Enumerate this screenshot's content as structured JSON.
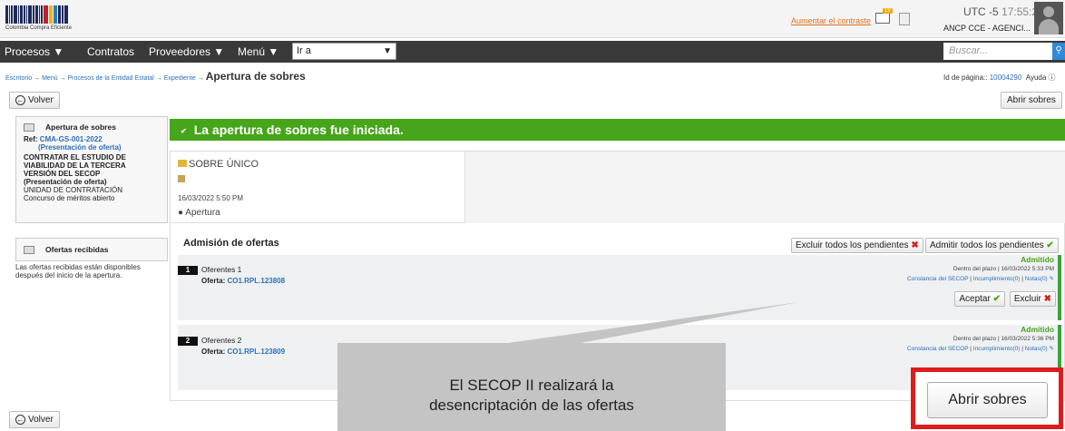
{
  "header": {
    "logo_text": "Colombia Compra Eficiente",
    "contrast_link": "Aumentar el contraste",
    "mail_badge": "19",
    "clock_tz": "UTC -5",
    "clock_time": "17:55:28",
    "account": "ANCP CCE - AGENCI..."
  },
  "nav": {
    "items": [
      "Procesos ▼",
      "Contratos",
      "Proveedores ▼",
      "Menú ▼"
    ],
    "goto_value": "Ir a",
    "search_placeholder": "Buscar..."
  },
  "breadcrumb": {
    "items": [
      "Escritorio",
      "Menú",
      "Procesos de la Entidad Estatal",
      "Expediente"
    ],
    "arrow": "→",
    "current": "Apertura de sobres"
  },
  "page_id": {
    "label": "Id de página::",
    "value": "10004290",
    "help": "Ayuda"
  },
  "buttons": {
    "back": "Volver",
    "open_envelopes": "Abrir sobres",
    "exclude_all": "Excluir todos los pendientes",
    "admit_all": "Admitir todos los pendientes",
    "accept": "Aceptar",
    "exclude": "Excluir",
    "big_open": "Abrir sobres"
  },
  "left_panel": {
    "title": "Apertura de sobres",
    "ref_label": "Ref:",
    "ref_code": "CMA-GS-001-2022",
    "ref_sub": "(Presentación de oferta)",
    "description": "CONTRATAR EL ESTUDIO DE VIABILIDAD DE LA TERCERA VERSIÓN DEL SECOP",
    "description_sub": "(Presentación de oferta)",
    "unit": "UNIDAD DE CONTRATACIÓN",
    "type": "Concurso de méritos abierto",
    "offers_title": "Ofertas recibidas",
    "offers_note": "Las ofertas recibidas están disponibles después del inicio de la apertura."
  },
  "success_message": "La apertura de sobres fue iniciada.",
  "sobre": {
    "name": "SOBRE ÚNICO",
    "date": "16/03/2022 5:50 PM",
    "phase": "Apertura"
  },
  "admision": {
    "title": "Admisión de ofertas",
    "offers": [
      {
        "number": "1",
        "name": "Oferentes 1",
        "offer_label": "Oferta:",
        "offer_id": "CO1.RPL.123808",
        "status": "Admitido",
        "plazo": "Dentro del plazo | 16/03/2022 5:33 PM",
        "constancia": "Constancia del SECOP",
        "incumplimiento": "Incumplimiento(0)",
        "notas": "Notas(0)"
      },
      {
        "number": "2",
        "name": "Oferentes 2",
        "offer_label": "Oferta:",
        "offer_id": "CO1.RPL.123809",
        "status": "Admitido",
        "plazo": "Dentro del plazo | 16/03/2022 5:36 PM",
        "constancia": "Constancia del SECOP",
        "incumplimiento": "Incumplimiento(0)",
        "notas": "Notas(0)"
      }
    ]
  },
  "callout": {
    "line1": "El SECOP II realizará la",
    "line2": "desencriptación de las ofertas"
  },
  "colors": {
    "success_green": "#46a51a",
    "nav_dark": "#3a3a3a",
    "link_blue": "#2f6fb5",
    "highlight_red": "#e01b1b",
    "callout_gray": "#c4c4c4"
  }
}
